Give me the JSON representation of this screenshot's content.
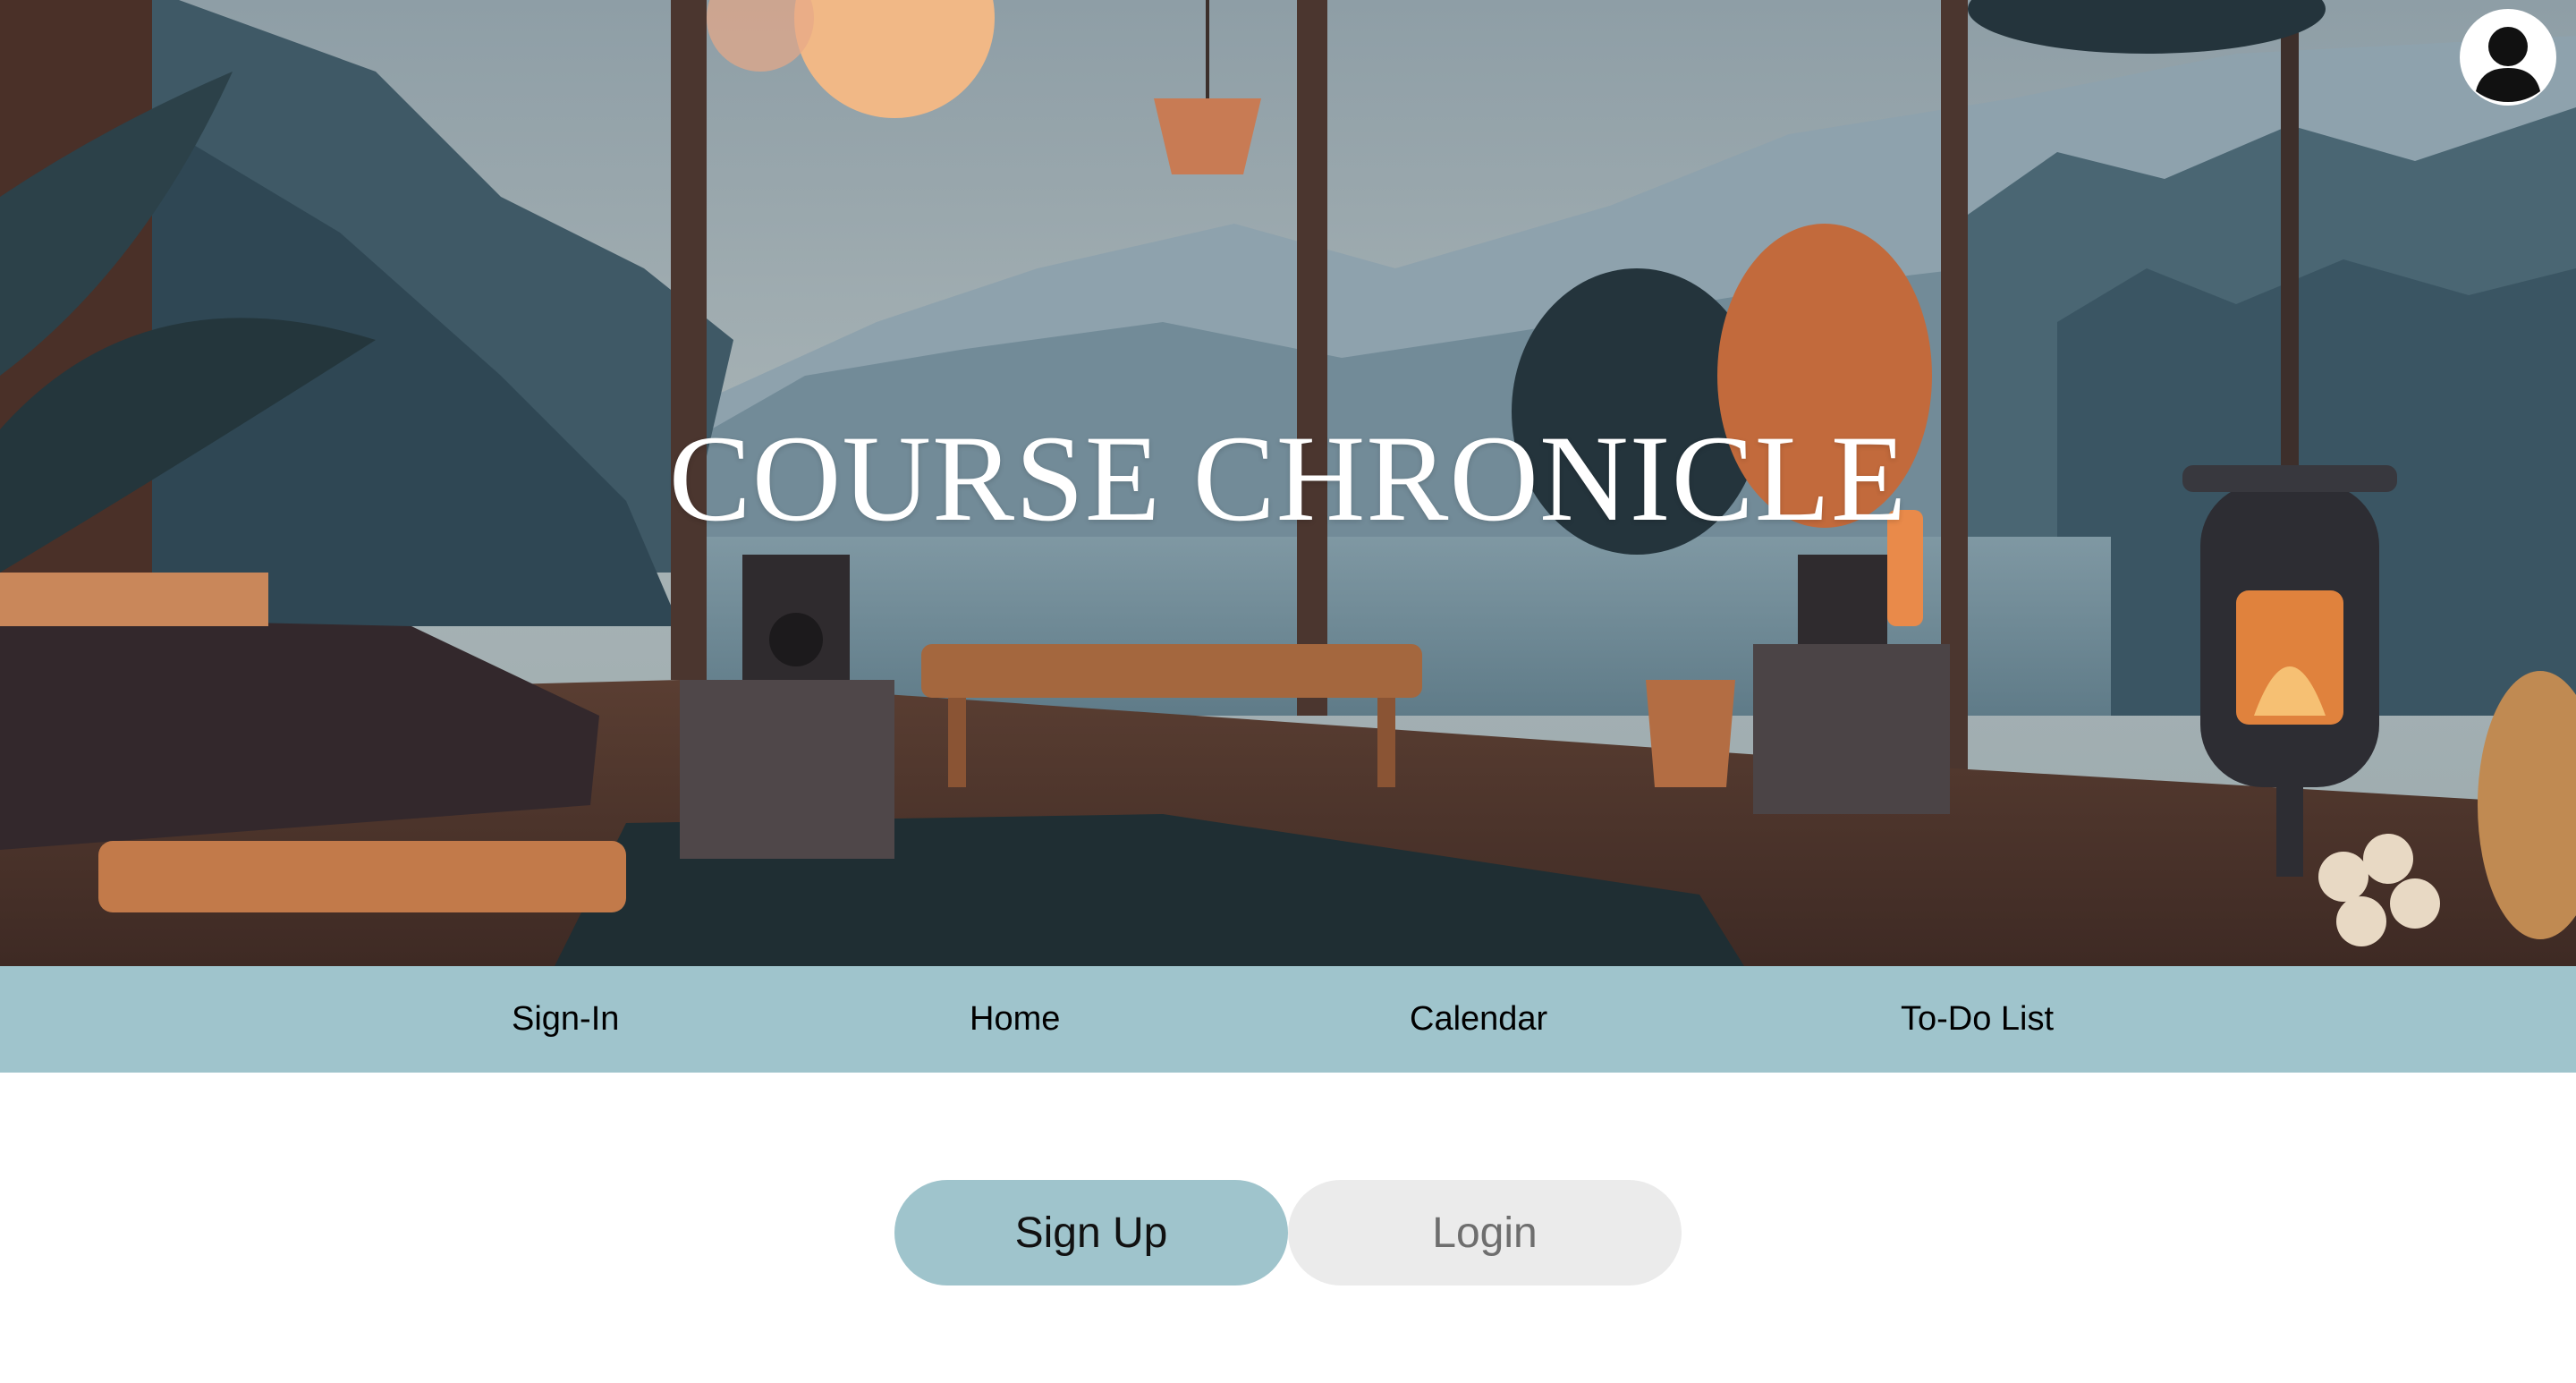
{
  "hero": {
    "title": "COURSE CHRONICLE"
  },
  "header": {
    "avatar_icon": "user-profile-icon"
  },
  "nav": {
    "items": [
      {
        "label": "Sign-In"
      },
      {
        "label": "Home"
      },
      {
        "label": "Calendar"
      },
      {
        "label": "To-Do List"
      }
    ]
  },
  "auth": {
    "signup_label": "Sign Up",
    "login_label": "Login",
    "active": "Sign Up"
  },
  "colors": {
    "accent": "#9fc4cc",
    "inactive_button": "#ebebeb",
    "inactive_text": "#6e6e6e",
    "title_text": "#ffffff"
  }
}
